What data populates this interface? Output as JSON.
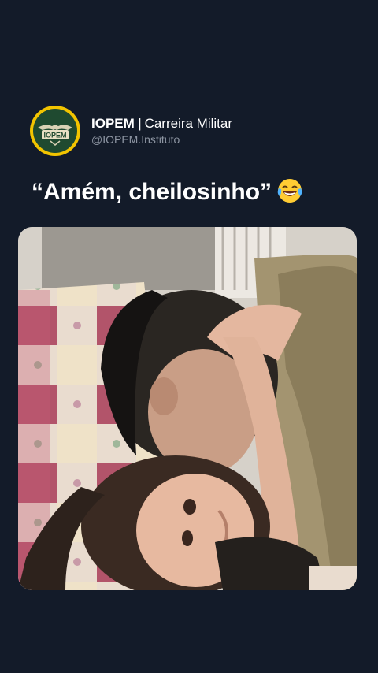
{
  "tweet": {
    "account": {
      "name": "IOPEM",
      "separator": "|",
      "subtitle": "Carreira Militar",
      "handle": "@IOPEM.Instituto",
      "avatar_logo_text": "IOPEM",
      "avatar_ring_color": "#f2c400",
      "avatar_bg_color": "#1f4a30"
    },
    "caption": "“Amém, cheilosinho”",
    "caption_emoji": "face-with-tears-of-joy-icon",
    "media": {
      "kind": "photo",
      "description_icon": "photo-man-hugging-baby"
    }
  },
  "colors": {
    "background": "#131b29",
    "text": "#ffffff",
    "muted_text": "#8e96a3"
  }
}
